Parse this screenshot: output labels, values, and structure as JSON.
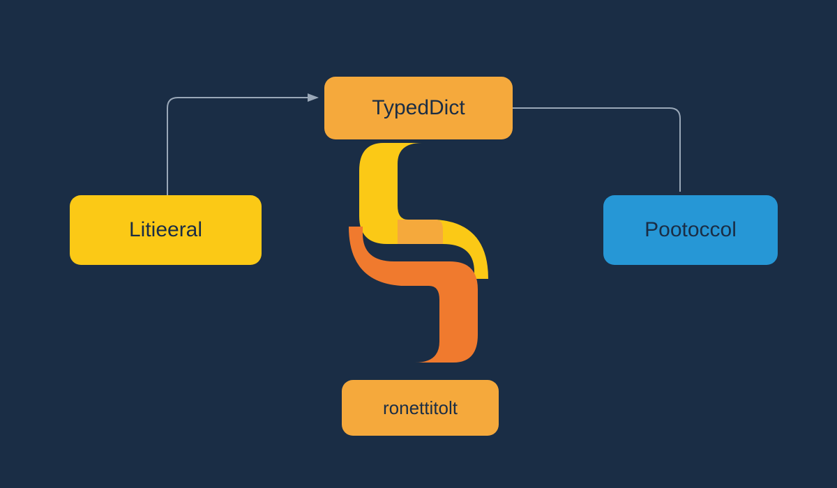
{
  "nodes": {
    "top": {
      "label": "TypedDict"
    },
    "left": {
      "label": "Litieeral"
    },
    "right": {
      "label": "Pootoccol"
    },
    "bottom": {
      "label": "ronettitolt"
    }
  },
  "colors": {
    "background": "#1a2d45",
    "orange": "#f5a93c",
    "yellow": "#fbc916",
    "blue": "#2697d6",
    "deep_orange": "#f07a2e",
    "connector": "#9aa8b8"
  }
}
